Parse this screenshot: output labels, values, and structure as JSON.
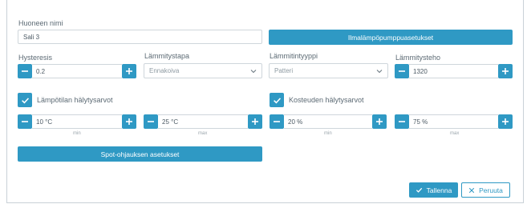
{
  "form": {
    "room_name_label": "Huoneen nimi",
    "room_name_value": "Sali 3",
    "heatpump_settings_label": "Ilmalämpöpumppuasetukset",
    "hysteresis_label": "Hysteresis",
    "hysteresis_value": "0.2",
    "heating_method_label": "Lämmitystapa",
    "heating_method_value": "Ennakoiva",
    "heater_type_label": "Lämmitintyyppi",
    "heater_type_value": "Patteri",
    "heating_power_label": "Lämmitysteho",
    "heating_power_value": "1320",
    "temp_alarm_label": "Lämpötilan hälytysarvot",
    "temp_min_value": "10 °C",
    "temp_max_value": "25 °C",
    "humidity_alarm_label": "Kosteuden hälytysarvot",
    "humidity_min_value": "20 %",
    "humidity_max_value": "75 %",
    "min_caption": "min",
    "max_caption": "max",
    "spot_settings_label": "Spot-ohjauksen asetukset",
    "save_label": "Tallenna",
    "cancel_label": "Peruuta"
  },
  "colors": {
    "accent": "#2f99c4",
    "border": "#cfd6db"
  },
  "icons": [
    "minus-icon",
    "plus-icon",
    "check-icon",
    "chevron-down-icon",
    "close-icon"
  ]
}
